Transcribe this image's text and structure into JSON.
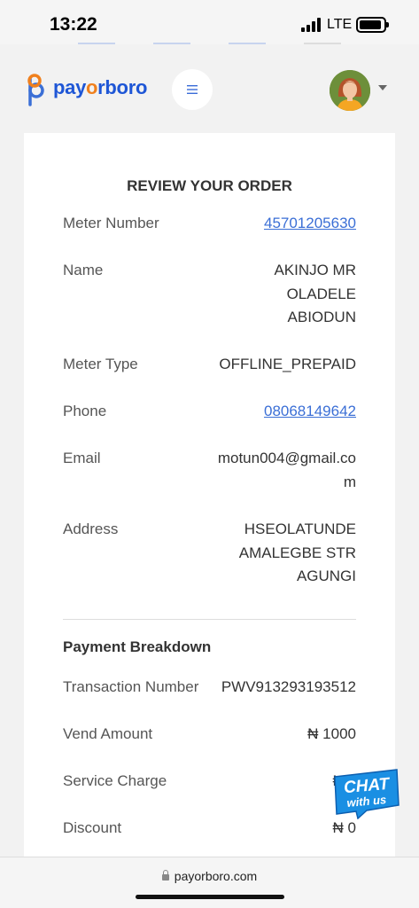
{
  "status_bar": {
    "time": "13:22",
    "network": "LTE"
  },
  "header": {
    "brand": {
      "pre": "pay",
      "o": "o",
      "post": "rboro"
    },
    "menu_icon": "hamburger-icon"
  },
  "order": {
    "title": "REVIEW YOUR ORDER",
    "meter_number": {
      "label": "Meter Number",
      "value": "45701205630"
    },
    "name": {
      "label": "Name",
      "lines": [
        "AKINJO MR",
        "OLADELE",
        "ABIODUN"
      ]
    },
    "meter_type": {
      "label": "Meter Type",
      "value": "OFFLINE_PREPAID"
    },
    "phone": {
      "label": "Phone",
      "value": "08068149642"
    },
    "email": {
      "label": "Email",
      "lines": [
        "motun004@gmail.co",
        "m"
      ]
    },
    "address": {
      "label": "Address",
      "lines": [
        "HSEOLATUNDE",
        "AMALEGBE STR",
        "AGUNGI"
      ]
    }
  },
  "payment": {
    "title": "Payment Breakdown",
    "transaction_number": {
      "label": "Transaction Number",
      "value": "PWV913293193512"
    },
    "vend_amount": {
      "label": "Vend Amount",
      "value": "₦ 1000"
    },
    "service_charge": {
      "label": "Service Charge",
      "value": "₦ 1"
    },
    "discount": {
      "label": "Discount",
      "value": "₦ 0"
    }
  },
  "chat_badge": {
    "line1": "CHAT",
    "line2": "with us"
  },
  "browser": {
    "url": "payorboro.com"
  },
  "colors": {
    "brand_blue": "#1e56d6",
    "brand_orange": "#f0801d",
    "link": "#3b6fd6",
    "chat_blue": "#1a8fe3"
  }
}
